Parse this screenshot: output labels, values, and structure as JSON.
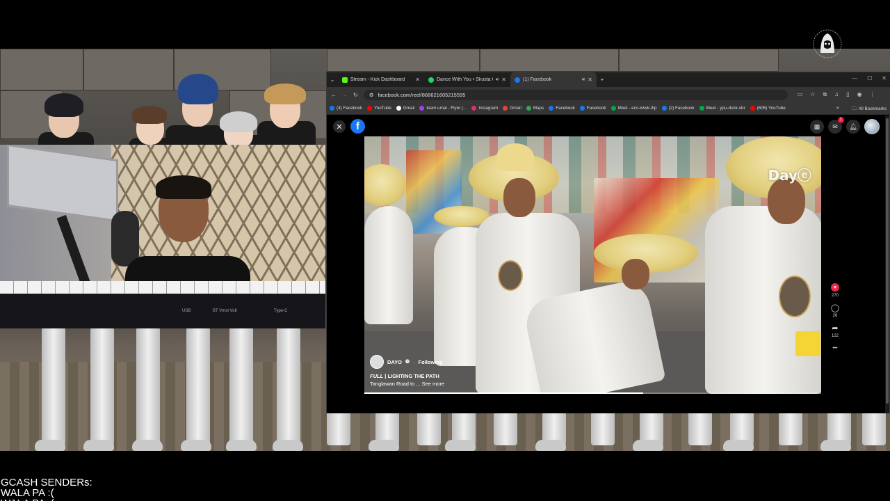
{
  "browser": {
    "tabs": [
      {
        "label": "Stream - Kick Dashboard",
        "favicon_color": "#53fc18",
        "audio": false
      },
      {
        "label": "Dance With You • Skusta Cl",
        "favicon_color": "#1ed760",
        "audio": true
      },
      {
        "label": "(1) Facebook",
        "favicon_color": "#1877f2",
        "audio": true,
        "active": true
      }
    ],
    "new_tab_symbol": "+",
    "url": "facebook.com/reel/868621605215595",
    "bookmarks": [
      {
        "label": "(4) Facebook",
        "color": "#1877f2"
      },
      {
        "label": "YouTube",
        "color": "#ff0000"
      },
      {
        "label": "Gmail",
        "color": "#ffffff"
      },
      {
        "label": "team umal - Flyer (...",
        "color": "#a142f4"
      },
      {
        "label": "Instagram",
        "color": "#e1306c"
      },
      {
        "label": "Gmail",
        "color": "#ea4335"
      },
      {
        "label": "Maps",
        "color": "#34a853"
      },
      {
        "label": "Facebook",
        "color": "#1877f2"
      },
      {
        "label": "Facebook",
        "color": "#1877f2"
      },
      {
        "label": "Meet - ecs-kwvk-ihp",
        "color": "#00ac47"
      },
      {
        "label": "(2) Facebook",
        "color": "#1877f2"
      },
      {
        "label": "Meet - ypu-dsnk-sbr",
        "color": "#00ac47"
      },
      {
        "label": "(606) YouTube",
        "color": "#ff0000"
      }
    ],
    "bookmarks_more": "»",
    "all_bookmarks": "All Bookmarks"
  },
  "facebook": {
    "logo_letter": "f",
    "notification_badge": "1",
    "reel": {
      "author": "DAYO",
      "follow_status": "Following",
      "title_italic": "FULL",
      "title_rest": " | LIGHTING THE PATH",
      "caption": "Tanglawan Road to ... See more",
      "watermark": "Day",
      "progress": 0.61
    },
    "actions": {
      "likes": "270",
      "comments": "26",
      "shares": "122",
      "more": "•••"
    }
  },
  "webcam": {
    "keyboard_labels": [
      "USB",
      "BT  Vmst   Volt",
      "Type-C"
    ]
  },
  "overlay": {
    "gcash_title": "GCASH SENDERs:",
    "gcash_line": "WALA PA :("
  }
}
